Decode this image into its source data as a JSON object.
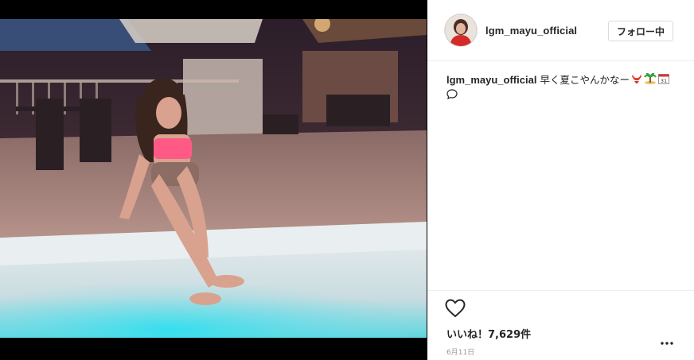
{
  "post": {
    "username": "lgm_mayu_official",
    "follow_label": "フォロー中",
    "caption_user": "lgm_mayu_official",
    "caption_text": "早く夏こやんかなー",
    "caption_emoji_icons": [
      "bikini-icon",
      "palm-island-icon",
      "calendar-icon"
    ],
    "calendar_day": "31",
    "likes_label": "いいね！7,629件",
    "date": "6月11日",
    "photo_icon": "pool-night-photo"
  },
  "colors": {
    "text": "#262626",
    "muted": "#999999",
    "border": "#dbdbdb"
  }
}
